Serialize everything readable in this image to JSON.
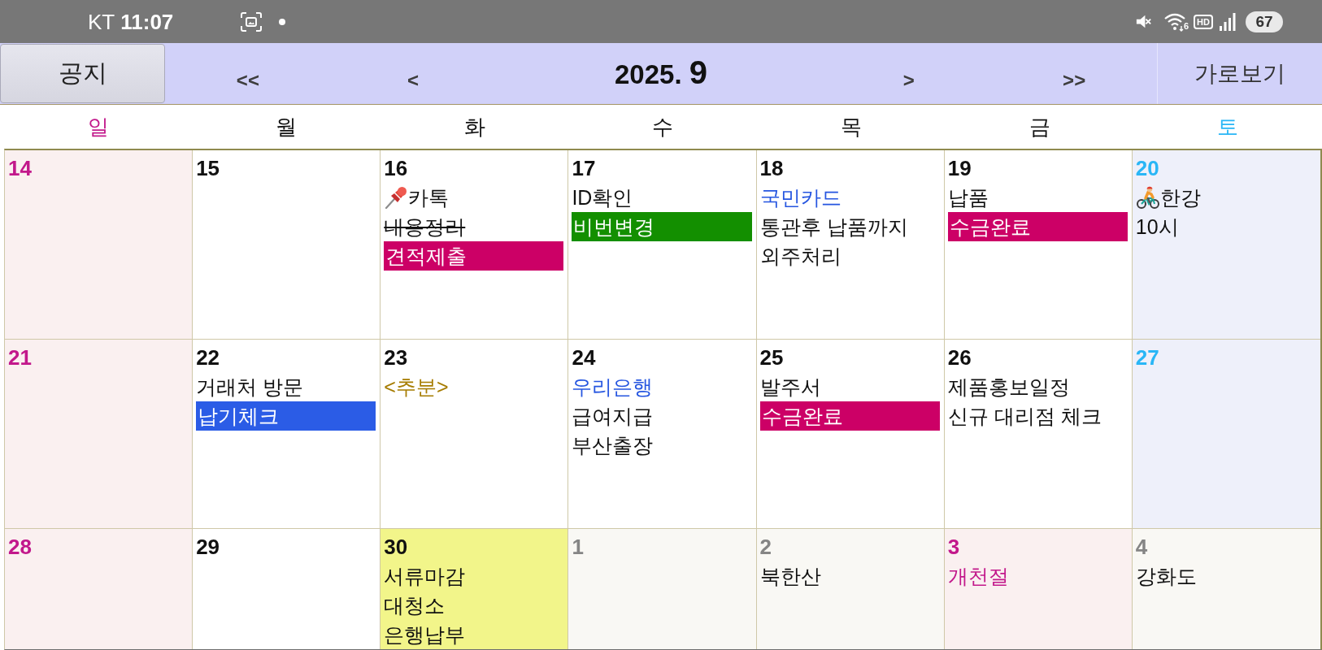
{
  "status_bar": {
    "carrier": "KT",
    "time": "11:07",
    "wifi_generation": "6",
    "hd_label": "HD",
    "battery": "67"
  },
  "header": {
    "notice_button": "공지",
    "prev_year": "<<",
    "prev_month": "<",
    "year": "2025.",
    "month": "9",
    "next_month": ">",
    "next_year": ">>",
    "landscape_button": "가로보기"
  },
  "weekdays": [
    {
      "label": "일",
      "kind": "sunday"
    },
    {
      "label": "월",
      "kind": "weekday"
    },
    {
      "label": "화",
      "kind": "weekday"
    },
    {
      "label": "수",
      "kind": "weekday"
    },
    {
      "label": "목",
      "kind": "weekday"
    },
    {
      "label": "금",
      "kind": "weekday"
    },
    {
      "label": "토",
      "kind": "saturday"
    }
  ],
  "weeks": [
    [
      {
        "day": "14",
        "kind": "sunday",
        "today": false
      },
      {
        "day": "15",
        "kind": "weekday",
        "today": false
      },
      {
        "day": "16",
        "kind": "weekday",
        "today": false,
        "events": [
          {
            "text": "카톡",
            "kind": "pinned",
            "color": "#111111"
          },
          {
            "text": "내용정리",
            "kind": "struck",
            "color": "#111111"
          },
          {
            "text": "견적제출",
            "kind": "bar",
            "color": "#cc0066"
          }
        ]
      },
      {
        "day": "17",
        "kind": "weekday",
        "today": false,
        "events": [
          {
            "text": "ID확인",
            "kind": "text",
            "color": "#111111"
          },
          {
            "text": "비번변경",
            "kind": "bar",
            "color": "#138f00"
          }
        ]
      },
      {
        "day": "18",
        "kind": "weekday",
        "today": false,
        "events": [
          {
            "text": "국민카드",
            "kind": "text",
            "color": "#2656e0"
          },
          {
            "text": "통관후 납품까지",
            "kind": "text",
            "color": "#111111"
          },
          {
            "text": "외주처리",
            "kind": "text",
            "color": "#111111"
          }
        ]
      },
      {
        "day": "19",
        "kind": "weekday",
        "today": false,
        "events": [
          {
            "text": "납품",
            "kind": "text",
            "color": "#111111"
          },
          {
            "text": "수금완료",
            "kind": "bar",
            "color": "#cc0066"
          }
        ]
      },
      {
        "day": "20",
        "kind": "saturday",
        "today": false,
        "events": [
          {
            "text": "한강",
            "kind": "cycling",
            "color": "#111111"
          },
          {
            "text": "10시",
            "kind": "text",
            "color": "#111111"
          }
        ]
      }
    ],
    [
      {
        "day": "21",
        "kind": "sunday",
        "today": false
      },
      {
        "day": "22",
        "kind": "weekday",
        "today": false,
        "events": [
          {
            "text": "거래처 방문",
            "kind": "text",
            "color": "#111111"
          },
          {
            "text": "납기체크",
            "kind": "bar",
            "color": "#2b5ce6"
          }
        ]
      },
      {
        "day": "23",
        "kind": "weekday",
        "today": false,
        "events": [
          {
            "text": "<추분>",
            "kind": "text",
            "color": "#a67c00"
          }
        ]
      },
      {
        "day": "24",
        "kind": "weekday",
        "today": false,
        "events": [
          {
            "text": "우리은행",
            "kind": "text",
            "color": "#2656e0"
          },
          {
            "text": "급여지급",
            "kind": "text",
            "color": "#111111"
          },
          {
            "text": "부산출장",
            "kind": "text",
            "color": "#111111"
          }
        ]
      },
      {
        "day": "25",
        "kind": "weekday",
        "today": false,
        "events": [
          {
            "text": "발주서",
            "kind": "text",
            "color": "#111111"
          },
          {
            "text": "수금완료",
            "kind": "bar",
            "color": "#cc0066"
          }
        ]
      },
      {
        "day": "26",
        "kind": "weekday",
        "today": false,
        "events": [
          {
            "text": "제품홍보일정",
            "kind": "text",
            "color": "#111111"
          },
          {
            "text": "신규 대리점 체크",
            "kind": "text",
            "color": "#111111"
          }
        ]
      },
      {
        "day": "27",
        "kind": "saturday",
        "today": false
      }
    ],
    [
      {
        "day": "28",
        "kind": "sunday",
        "today": false
      },
      {
        "day": "29",
        "kind": "weekday",
        "today": false
      },
      {
        "day": "30",
        "kind": "weekday",
        "today": true,
        "events": [
          {
            "text": "서류마감",
            "kind": "text",
            "color": "#111111"
          },
          {
            "text": "대청소",
            "kind": "text",
            "color": "#111111"
          },
          {
            "text": "은행납부",
            "kind": "text",
            "color": "#111111"
          }
        ]
      },
      {
        "day": "1",
        "kind": "other_month",
        "today": false
      },
      {
        "day": "2",
        "kind": "other_month",
        "today": false,
        "events": [
          {
            "text": "북한산",
            "kind": "text",
            "color": "#111111"
          }
        ]
      },
      {
        "day": "3",
        "kind": "holiday",
        "today": false,
        "events": [
          {
            "text": "개천절",
            "kind": "text",
            "color": "#c2188b"
          }
        ]
      },
      {
        "day": "4",
        "kind": "other_month",
        "today": false,
        "events": [
          {
            "text": "강화도",
            "kind": "text",
            "color": "#111111"
          }
        ]
      }
    ]
  ]
}
